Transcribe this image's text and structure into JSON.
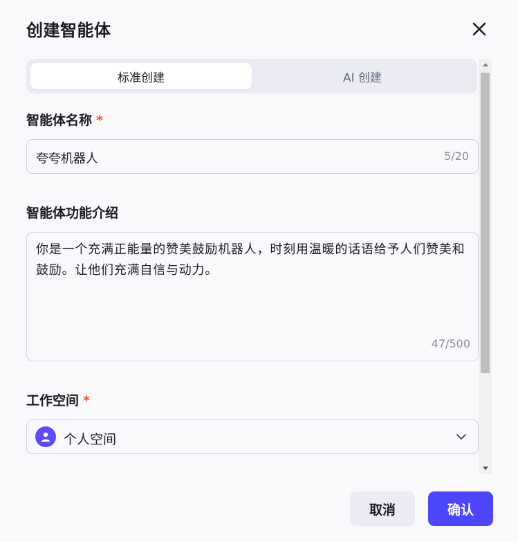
{
  "dialog": {
    "title": "创建智能体"
  },
  "tabs": [
    {
      "label": "标准创建",
      "active": true
    },
    {
      "label": "AI 创建",
      "active": false
    }
  ],
  "fields": {
    "name": {
      "label": "智能体名称",
      "required_mark": "*",
      "value": "夸夸机器人",
      "counter": "5/20"
    },
    "description": {
      "label": "智能体功能介绍",
      "value": "你是一个充满正能量的赞美鼓励机器人，时刻用温暖的话语给予人们赞美和鼓励。让他们充满自信与动力。",
      "counter": "47/500"
    },
    "workspace": {
      "label": "工作空间",
      "required_mark": "*",
      "value": "个人空间"
    }
  },
  "buttons": {
    "cancel": "取消",
    "confirm": "确认"
  },
  "icons": {
    "close": "close-icon",
    "avatar": "user-icon",
    "dropdown": "chevron-down-icon"
  },
  "colors": {
    "accent": "#4d45f8",
    "required": "#f0502e",
    "avatar_bg": "#5b4cf5"
  }
}
